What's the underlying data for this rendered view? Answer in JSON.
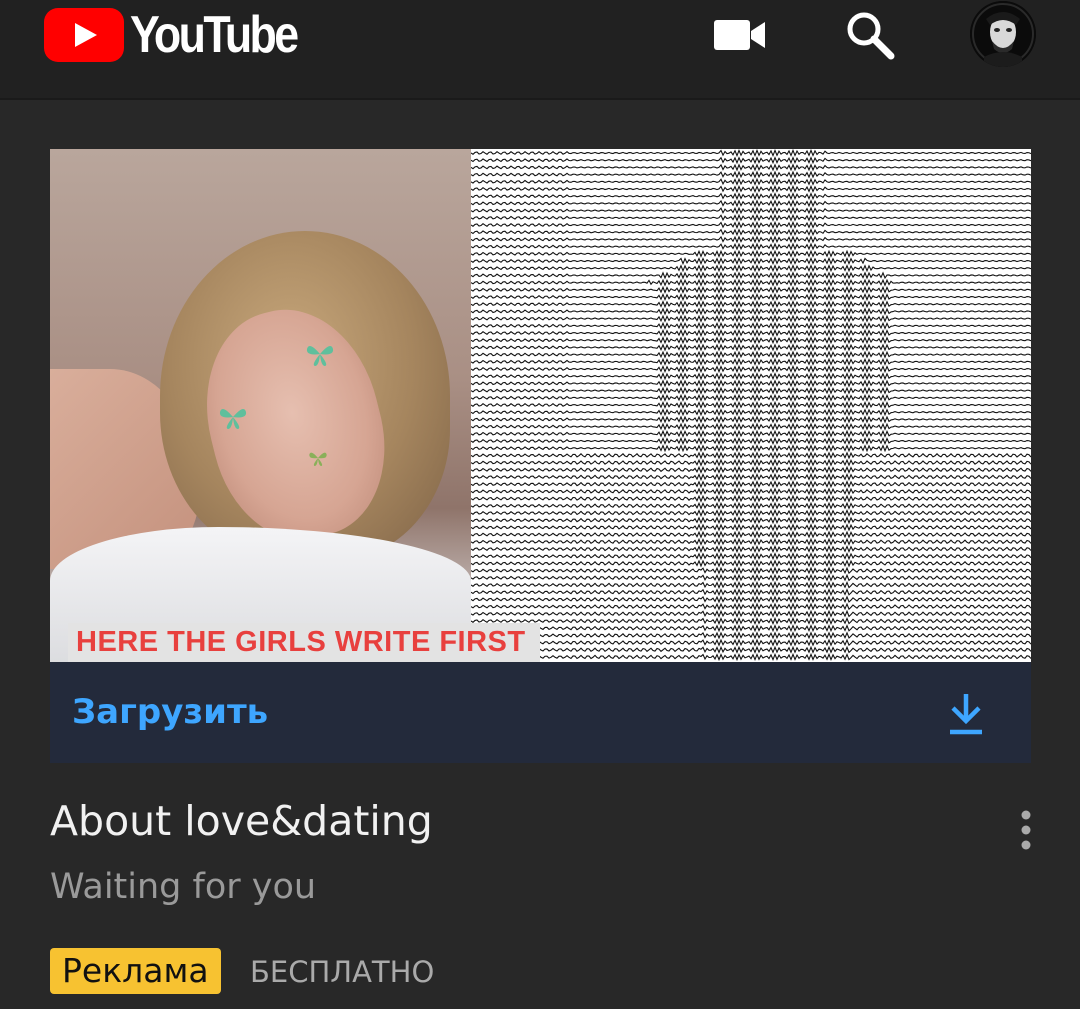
{
  "header": {
    "logo_text": "YouTube",
    "icons": [
      "video-camera-icon",
      "search-icon",
      "avatar"
    ]
  },
  "ad": {
    "thumbnail_caption": "HERE THE GIRLS WRITE FIRST",
    "action_label": "Загрузить",
    "title": "About love&dating",
    "subtitle": "Waiting for you",
    "badge": "Реклама",
    "price": "БЕСПЛАТНО"
  },
  "colors": {
    "accent": "#3ea6ff",
    "badge_bg": "#f7c231",
    "youtube_red": "#ff0000",
    "background": "#282828"
  }
}
